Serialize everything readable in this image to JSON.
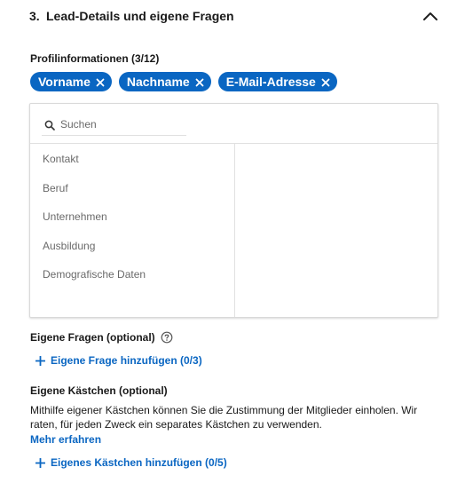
{
  "section": {
    "number": "3.",
    "title": "Lead-Details und eigene Fragen"
  },
  "profile": {
    "label": "Profilinformationen (3/12)",
    "chips": [
      "Vorname",
      "Nachname",
      "E-Mail-Adresse"
    ]
  },
  "picker": {
    "search_placeholder": "Suchen",
    "categories": [
      "Kontakt",
      "Beruf",
      "Unternehmen",
      "Ausbildung",
      "Demografische Daten"
    ]
  },
  "custom_questions": {
    "title": "Eigene Fragen (optional)",
    "add_label": "Eigene Frage hinzufügen (0/3)"
  },
  "custom_checkboxes": {
    "title": "Eigene Kästchen (optional)",
    "description": "Mithilfe eigener Kästchen können Sie die Zustimmung der Mitglieder einholen. Wir raten, für jeden Zweck ein separates Kästchen zu verwenden.",
    "learn_more": "Mehr erfahren",
    "add_label": "Eigenes Kästchen hinzufügen (0/5)"
  },
  "icons": {
    "collapse": "chevron-up-icon",
    "chip_remove": "close-icon",
    "search": "search-icon",
    "help": "help-circle-icon",
    "add": "plus-icon"
  },
  "colors": {
    "accent": "#0a66c2",
    "text_primary": "#1f1f1f",
    "text_secondary": "#666666",
    "border": "#d9d9d9"
  }
}
